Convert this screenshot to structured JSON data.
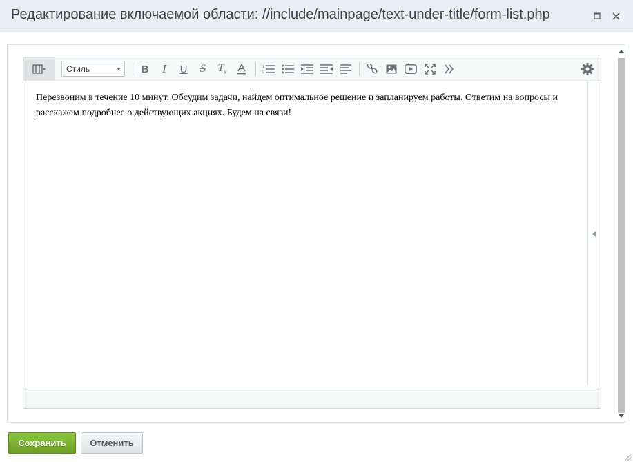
{
  "dialog": {
    "title": "Редактирование включаемой области: //include/mainpage/text-under-title/form-list.php",
    "maximize_icon": "maximize-icon",
    "close_icon": "close-icon"
  },
  "toolbar": {
    "mode_icon": "view-mode-icon",
    "style_select": {
      "value": "Стиль"
    },
    "tools": [
      {
        "name": "bold",
        "icon": "bold-icon"
      },
      {
        "name": "italic",
        "icon": "italic-icon"
      },
      {
        "name": "underline",
        "icon": "underline-icon"
      },
      {
        "name": "strikethrough",
        "icon": "strikethrough-icon"
      },
      {
        "name": "remove-format",
        "icon": "clear-format-icon"
      },
      {
        "name": "font-color",
        "icon": "text-color-icon"
      },
      {
        "name": "ordered-list",
        "icon": "ordered-list-icon"
      },
      {
        "name": "unordered-list",
        "icon": "unordered-list-icon"
      },
      {
        "name": "indent",
        "icon": "indent-icon"
      },
      {
        "name": "outdent",
        "icon": "outdent-icon"
      },
      {
        "name": "align",
        "icon": "align-left-icon"
      },
      {
        "name": "link",
        "icon": "link-icon"
      },
      {
        "name": "image",
        "icon": "image-icon"
      },
      {
        "name": "video",
        "icon": "video-icon"
      },
      {
        "name": "fullscreen",
        "icon": "fullscreen-icon"
      },
      {
        "name": "more",
        "icon": "double-chevron-right-icon"
      },
      {
        "name": "settings",
        "icon": "gear-icon"
      }
    ]
  },
  "editor": {
    "content": "Перезвоним в течение 10 минут. Обсудим задачи, найдем оптимальное решение и запланируем работы. Ответим на вопросы и расскажем подробнее о действующих акциях. Будем на связи!"
  },
  "buttons": {
    "save_label": "Сохранить",
    "cancel_label": "Отменить"
  },
  "colors": {
    "titlebar_bg": "#e8eef1",
    "save_green": "#7ab230",
    "toolbar_bg": "#f6f7f7"
  }
}
